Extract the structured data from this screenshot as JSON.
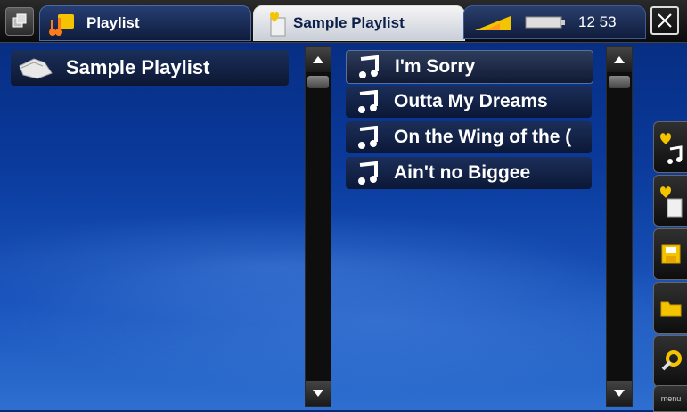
{
  "tabs": [
    {
      "label": "Playlist",
      "icon": "music-folder-icon"
    },
    {
      "label": "Sample Playlist",
      "icon": "playlist-heart-icon"
    }
  ],
  "status": {
    "time": "12 53",
    "battery_icon": "battery-icon",
    "wifi_icon": "signal-icon"
  },
  "left_panel": {
    "item": "Sample Playlist",
    "icon": "playlist-icon"
  },
  "songs": [
    {
      "title": "I'm Sorry"
    },
    {
      "title": "Outta My Dreams"
    },
    {
      "title": "On the Wing of the ("
    },
    {
      "title": "Ain't no Biggee"
    }
  ],
  "side_buttons": [
    "add-song-to-playlist-icon",
    "add-file-to-playlist-icon",
    "save-icon",
    "folder-icon",
    "tools-icon"
  ],
  "menu_label": "menu",
  "colors": {
    "accent_yellow": "#f5c400",
    "bg_blue": "#0a3a9c"
  }
}
